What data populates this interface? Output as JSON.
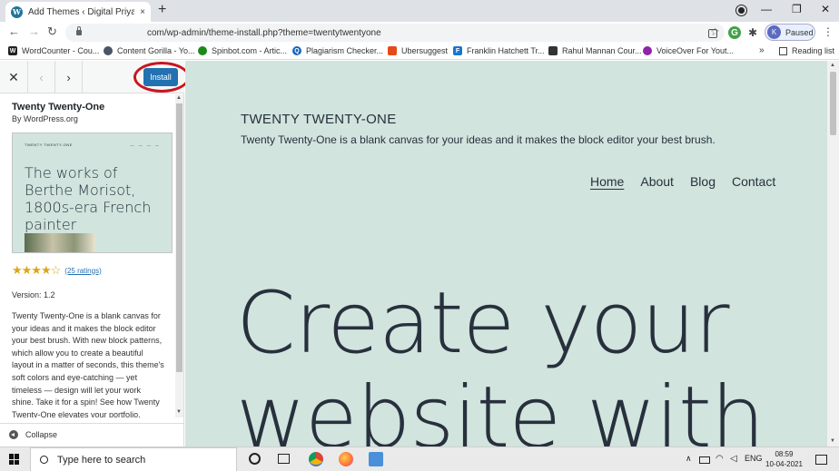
{
  "browser": {
    "tab_title": "Add Themes ‹ Digital Priyansh —",
    "tab_close": "×",
    "new_tab": "+",
    "url": "com/wp-admin/theme-install.php?theme=twentytwentyone",
    "profile_initial": "K",
    "profile_status": "Paused",
    "back": "←",
    "forward": "→",
    "reload": "↻",
    "star": "☆",
    "menu": "⋮",
    "minimize": "—",
    "restore": "❐",
    "close": "✕"
  },
  "bookmarks": {
    "items": [
      {
        "label": "WordCounter - Cou...",
        "icon": "W",
        "color": "#222"
      },
      {
        "label": "Content Gorilla - Yo...",
        "icon": "•",
        "color": "#4a5568"
      },
      {
        "label": "Spinbot.com - Artic...",
        "icon": "•",
        "color": "#1a8a1a"
      },
      {
        "label": "Plagiarism Checker...",
        "icon": "Q",
        "color": "#1565c0"
      },
      {
        "label": "Ubersuggest",
        "icon": "•",
        "color": "#e64a19"
      },
      {
        "label": "Franklin Hatchett Tr...",
        "icon": "F",
        "color": "#1976d2"
      },
      {
        "label": "Rahul Mannan Cour...",
        "icon": "•",
        "color": "#333"
      },
      {
        "label": "VoiceOver For Yout...",
        "icon": "•",
        "color": "#8e24aa"
      }
    ],
    "more": "»",
    "reading_list": "Reading list"
  },
  "sidebar": {
    "close": "✕",
    "prev": "‹",
    "next": "›",
    "install_label": "Install",
    "theme_name": "Twenty Twenty-One",
    "author": "By WordPress.org",
    "screenshot": {
      "mini_title": "TWENTY TWENTY-ONE",
      "mini_nav": "— — — —",
      "headline": "The works of Berthe Morisot, 1800s-era French painter"
    },
    "rating": {
      "stars_filled": 4,
      "stars_total": 5,
      "stars": "★★★★",
      "empty_star": "☆",
      "count_label": "(25 ratings)"
    },
    "version": "Version: 1.2",
    "description": "Twenty Twenty-One is a blank canvas for your ideas and it makes the block editor your best brush. With new block patterns, which allow you to create a beautiful layout in a matter of seconds, this theme's soft colors and eye-catching — yet timeless — design will let your work shine. Take it for a spin! See how Twenty Twenty-One elevates your portfolio, business website, or personal blog.",
    "collapse_label": "Collapse"
  },
  "preview": {
    "site_title": "TWENTY TWENTY-ONE",
    "site_description": "Twenty Twenty-One is a blank canvas for your ideas and it makes the block editor your best brush.",
    "nav": [
      "Home",
      "About",
      "Blog",
      "Contact"
    ],
    "hero": "Create your website with",
    "bg_color": "#d1e4dd"
  },
  "taskbar": {
    "search_placeholder": "Type here to search",
    "lang": "ENG",
    "time": "08:59",
    "date": "10-04-2021",
    "tray_up": "∧"
  },
  "colors": {
    "accent": "#2271b1",
    "highlight_ring": "#c9151e"
  }
}
